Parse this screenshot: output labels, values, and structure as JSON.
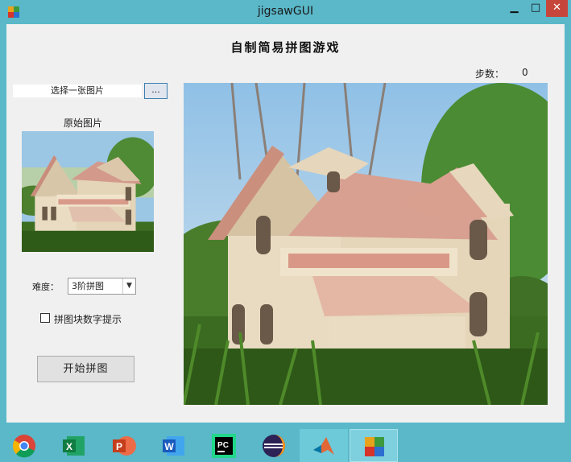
{
  "window": {
    "title": "jigsawGUI",
    "minimize_glyph": "▁",
    "maximize_glyph": "□",
    "close_glyph": "✕",
    "app_icon": "jigsaw-app-icon"
  },
  "app": {
    "heading": "自制简易拼图游戏",
    "steps_label": "步数：",
    "steps_value": "0",
    "choose_image_text": "选择一张图片",
    "browse_label": "...",
    "original_label": "原始图片",
    "difficulty_label": "难度：",
    "difficulty_selected": "3阶拼图",
    "difficulty_arrow": "▼",
    "number_hint_label": "拼图块数字提示",
    "number_hint_checked": false,
    "start_label": "开始拼图",
    "image_subject": "wooden-model-house-on-grass"
  },
  "taskbar": {
    "items": [
      {
        "icon": "chrome-icon",
        "state": "normal"
      },
      {
        "icon": "excel-icon",
        "state": "normal"
      },
      {
        "icon": "powerpoint-icon",
        "state": "normal"
      },
      {
        "icon": "word-icon",
        "state": "normal"
      },
      {
        "icon": "pycharm-icon",
        "state": "normal"
      },
      {
        "icon": "eclipse-icon",
        "state": "normal"
      },
      {
        "icon": "matlab-icon",
        "state": "running"
      },
      {
        "icon": "jigsaw-app-icon",
        "state": "active"
      }
    ]
  },
  "colors": {
    "frame": "#5ab8c9",
    "close": "#c7463b",
    "client": "#f0f0f0",
    "taskbar": "#5ab8c8"
  }
}
